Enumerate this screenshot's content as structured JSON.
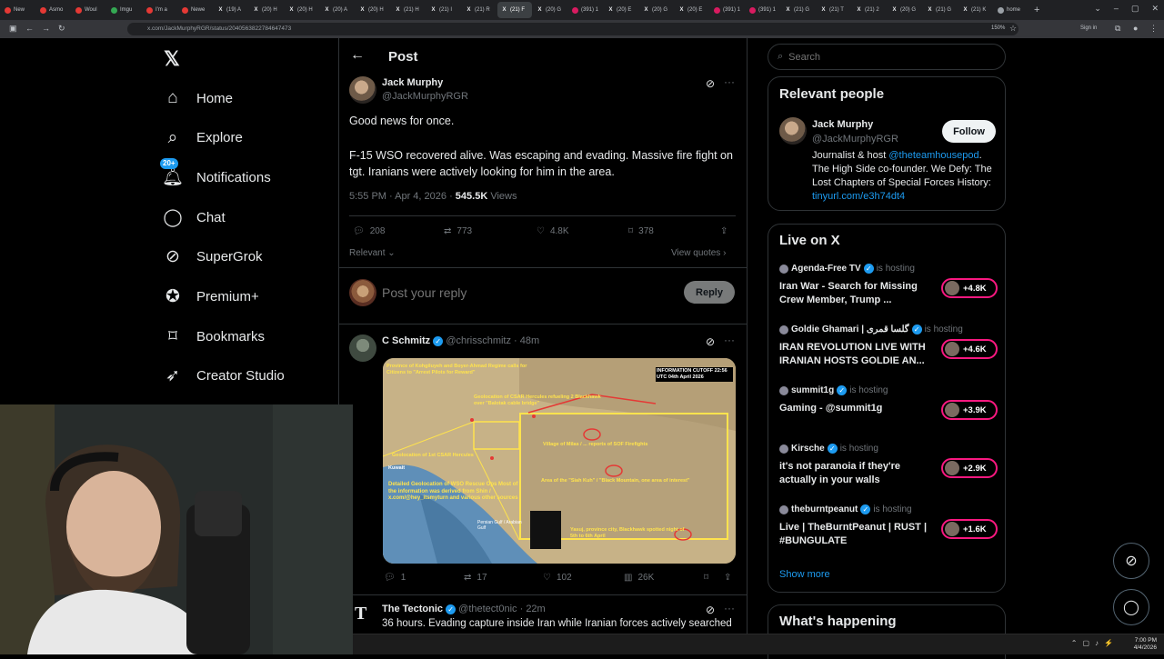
{
  "browser": {
    "tabs": [
      {
        "label": "New",
        "fav": "red"
      },
      {
        "label": "Asmo",
        "fav": "red"
      },
      {
        "label": "Woul",
        "fav": "red"
      },
      {
        "label": "Imgu",
        "fav": "grn"
      },
      {
        "label": "I'm a",
        "fav": "red"
      },
      {
        "label": "Newe",
        "fav": "red"
      },
      {
        "label": "(19) A",
        "fav": "x"
      },
      {
        "label": "(20) H",
        "fav": "x"
      },
      {
        "label": "(20) H",
        "fav": "x"
      },
      {
        "label": "(20) A",
        "fav": "x"
      },
      {
        "label": "(20) H",
        "fav": "x"
      },
      {
        "label": "(21) H",
        "fav": "x"
      },
      {
        "label": "(21) I",
        "fav": "x"
      },
      {
        "label": "(21) R",
        "fav": "x"
      },
      {
        "label": "(21) F",
        "fav": "x",
        "active": true
      },
      {
        "label": "(20) G",
        "fav": "x"
      },
      {
        "label": "(391) 1",
        "fav": "pink"
      },
      {
        "label": "(20) E",
        "fav": "x"
      },
      {
        "label": "(20) G",
        "fav": "x"
      },
      {
        "label": "(20) E",
        "fav": "x"
      },
      {
        "label": "(391) 1",
        "fav": "pink"
      },
      {
        "label": "(391) 1",
        "fav": "pink"
      },
      {
        "label": "(21) G",
        "fav": "x"
      },
      {
        "label": "(21) T",
        "fav": "x"
      },
      {
        "label": "(21) 2",
        "fav": "x"
      },
      {
        "label": "(20) G",
        "fav": "x"
      },
      {
        "label": "(21) G",
        "fav": "x"
      },
      {
        "label": "(21) K",
        "fav": "x"
      },
      {
        "label": "home",
        "fav": "gray"
      }
    ],
    "url": "x.com/JackMurphyRGR/status/2040563822784647473",
    "zoom": "150%",
    "sign_in": "Sign in"
  },
  "nav": {
    "items": [
      {
        "label": "Home",
        "icon": "home-icon"
      },
      {
        "label": "Explore",
        "icon": "search-icon"
      },
      {
        "label": "Notifications",
        "icon": "bell-icon",
        "badge": "20+"
      },
      {
        "label": "Chat",
        "icon": "chat-icon"
      },
      {
        "label": "SuperGrok",
        "icon": "grok-icon"
      },
      {
        "label": "Premium+",
        "icon": "premium-icon"
      },
      {
        "label": "Bookmarks",
        "icon": "bookmark-icon"
      },
      {
        "label": "Creator Studio",
        "icon": "rocket-icon"
      }
    ]
  },
  "header": {
    "title": "Post"
  },
  "post": {
    "author": "Jack Murphy",
    "handle": "@JackMurphyRGR",
    "line1": "Good news for once.",
    "line2": "F-15 WSO recovered alive. Was escaping and evading. Massive fire fight on tgt. Iranians were actively looking for him in the area.",
    "time": "5:55 PM · Apr 4, 2026 ·",
    "views_count": "545.5K",
    "views_label": "Views",
    "replies": "208",
    "reposts": "773",
    "likes": "4.8K",
    "bookmarks": "378",
    "sort": "Relevant",
    "view_quotes": "View quotes"
  },
  "reply_box": {
    "placeholder": "Post your reply",
    "button": "Reply"
  },
  "replies": [
    {
      "author": "C Schmitz",
      "handle": "@chrisschmitz",
      "time": "· 48m",
      "replies": "1",
      "reposts": "17",
      "likes": "102",
      "views": "26K"
    },
    {
      "author": "The Tectonic",
      "handle": "@thetect0nic",
      "time": "· 22m",
      "text": "36 hours. Evading capture inside Iran while Iranian forces actively searched"
    }
  ],
  "map_labels": {
    "top_left": "Province of Kohgiluyeh and Boyer-Ahmad Regime calls for Citizens to \"Arrest Pilots for Reward\"",
    "cutoff": "INFORMATION CUTOFF 22:56 UTC 04th April 2026",
    "csar": "Geolocation of CSAR Hercules refueling 2 Blackhawk over \"Balotak cable bridge\"",
    "first_csar": "Geolocation of 1st CSAR Hercules",
    "kuwait": "Kuwait",
    "milas": "Village of Milas / ... reports of SOF Firefights",
    "siah": "Area of the \"Siah Kuh\" / \"Black Mountain, one area of interest\"",
    "detailed": "Detailed Geolocation of WSO Rescue Ops Most of the information was derived from Shin / x.com/@hey_itsmyturn and various other sources",
    "gulf": "Persian Gulf / Arabian Gulf",
    "yasuj": "Yasuj, province city, Blackhawk spotted night of 5th to 6th April"
  },
  "search": {
    "placeholder": "Search"
  },
  "relevant_people": {
    "title": "Relevant people",
    "name": "Jack Murphy",
    "handle": "@JackMurphyRGR",
    "follow": "Follow",
    "bio_start": "Journalist & host ",
    "bio_link": "@theteamhousepod",
    "bio_mid": ". The High Side co-founder. We Defy: The Lost Chapters of Special Forces History: ",
    "bio_url": "tinyurl.com/e3h74dt4"
  },
  "live": {
    "title": "Live on X",
    "hosting": "is hosting",
    "items": [
      {
        "host": "Agenda-Free TV",
        "title": "Iran War - Search for Missing Crew Member, Trump ...",
        "count": "+4.8K"
      },
      {
        "host": "Goldie Ghamari | گلسا قمری",
        "title": "IRAN REVOLUTION LIVE WITH IRANIAN HOSTS GOLDIE AN...",
        "count": "+4.6K"
      },
      {
        "host": "summit1g",
        "title": "Gaming - @summit1g",
        "count": "+3.9K"
      },
      {
        "host": "Kirsche",
        "title": "it's not paranoia if they're actually in your walls",
        "count": "+2.9K"
      },
      {
        "host": "theburntpeanut",
        "title": "Live | TheBurntPeanut | RUST | #BUNGULATE",
        "count": "+1.6K"
      }
    ],
    "show_more": "Show more"
  },
  "whats_happening": {
    "title": "What's happening"
  },
  "taskbar": {
    "time": "7:00 PM",
    "date": "4/4/2026"
  },
  "colors": {
    "accent": "#1d9bf0",
    "live": "#f91880",
    "bg": "#000000",
    "text": "#e7e9ea",
    "muted": "#71767b"
  }
}
